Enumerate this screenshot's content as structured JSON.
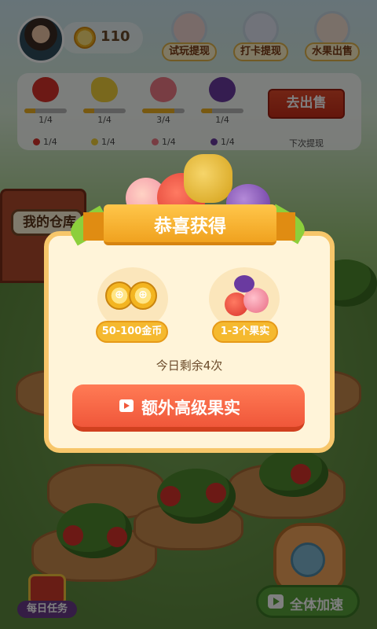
{
  "top_bar": {
    "coin_count": "110",
    "buttons": [
      {
        "label": "试玩提现",
        "icon": "red-envelope-icon"
      },
      {
        "label": "打卡提现",
        "icon": "calendar-check-icon"
      },
      {
        "label": "水果出售",
        "icon": "fruit-stall-icon"
      }
    ]
  },
  "panel": {
    "fruits": [
      {
        "name": "apple",
        "progress": "1/4",
        "fraction": 0.25,
        "mini": "1/4",
        "color": "#d8322a"
      },
      {
        "name": "banana",
        "progress": "1/4",
        "fraction": 0.25,
        "mini": "1/4",
        "color": "#f2d13a"
      },
      {
        "name": "peach",
        "progress": "3/4",
        "fraction": 0.75,
        "mini": "1/4",
        "color": "#f07a86"
      },
      {
        "name": "grape",
        "progress": "1/4",
        "fraction": 0.25,
        "mini": "1/4",
        "color": "#6a3aa0"
      }
    ],
    "sell_label": "去出售",
    "next_withdraw_label": "下次提现"
  },
  "scene": {
    "barn_label": "我的仓库"
  },
  "dialog": {
    "title": "恭喜获得",
    "rewards": [
      {
        "label": "50-100金币",
        "icon": "gold-coins-icon"
      },
      {
        "label": "1-3个果实",
        "icon": "fruit-bundle-icon"
      }
    ],
    "remaining": "今日剩余4次",
    "bonus_button": "额外高级果实"
  },
  "bottom": {
    "daily_task": "每日任务",
    "speed_up": "全体加速"
  },
  "colors": {
    "accent_orange": "#f0573a",
    "ribbon_gold": "#f0a21f",
    "dialog_border": "#f7c66a"
  }
}
